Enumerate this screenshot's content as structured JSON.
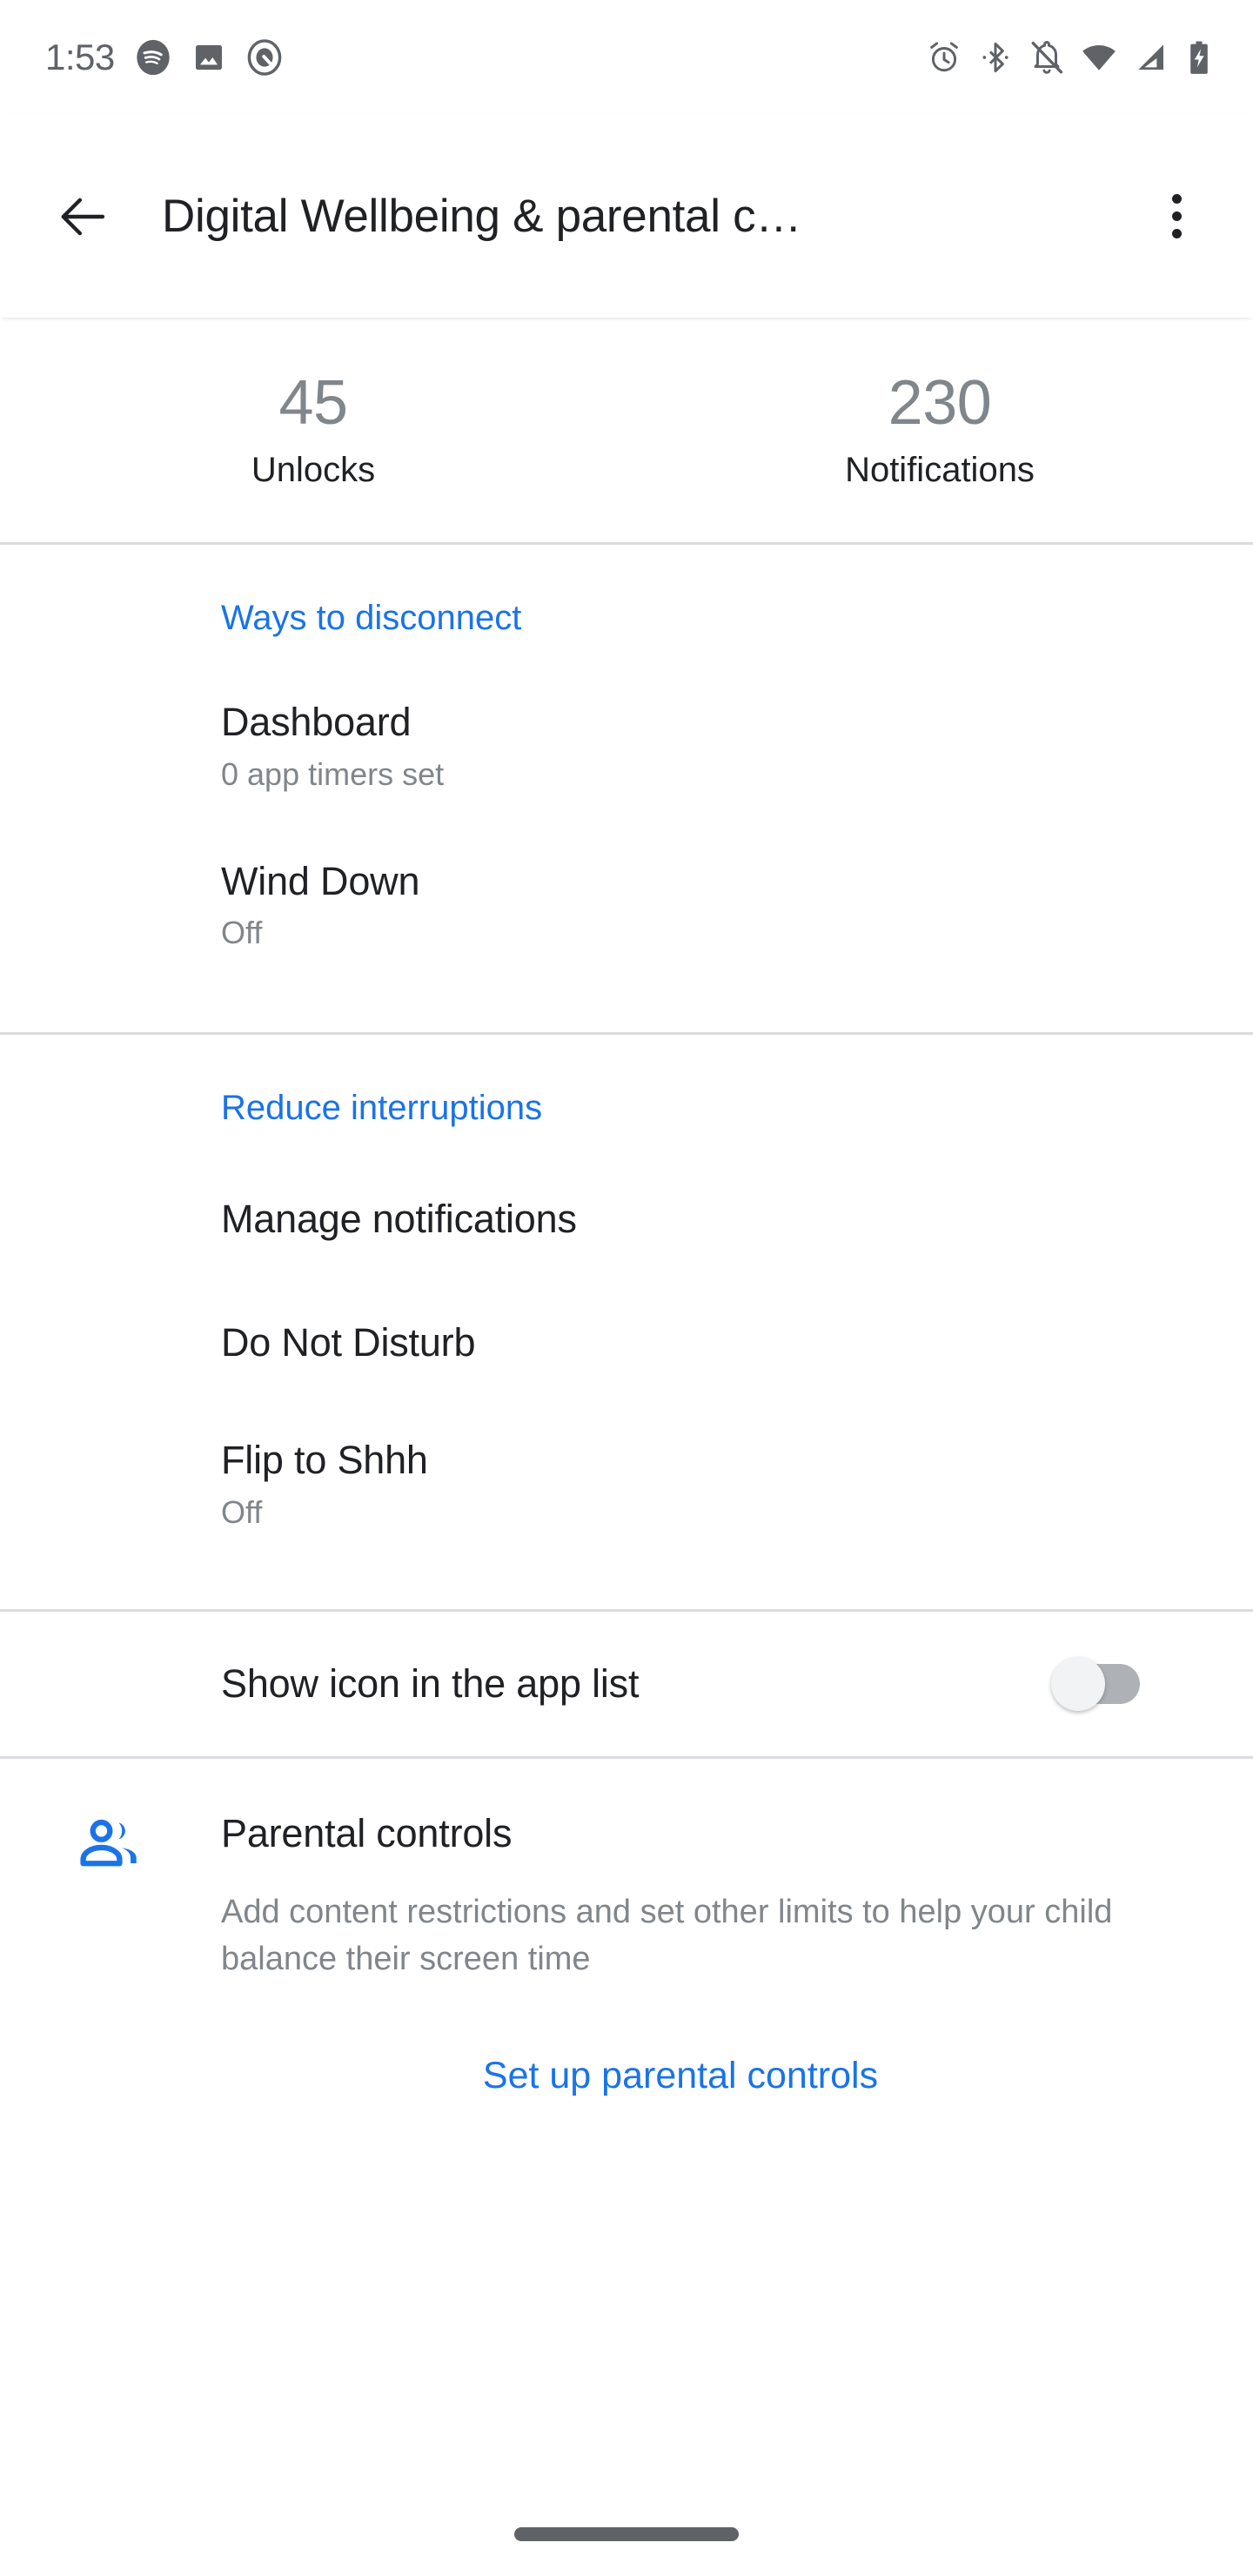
{
  "status_bar": {
    "time": "1:53",
    "left_icons": [
      "spotify-icon",
      "photos-image-icon",
      "android-auto-icon"
    ],
    "right_icons": [
      "alarm-icon",
      "bluetooth-icon",
      "notifications-off-icon",
      "wifi-icon",
      "cellular-signal-icon",
      "battery-charging-icon"
    ]
  },
  "toolbar": {
    "back_label": "back-arrow",
    "title": "Digital Wellbeing & parental c…",
    "overflow_label": "overflow-menu"
  },
  "stats": [
    {
      "value": "45",
      "label": "Unlocks"
    },
    {
      "value": "230",
      "label": "Notifications"
    }
  ],
  "sections": [
    {
      "header": "Ways to disconnect",
      "items": [
        {
          "title": "Dashboard",
          "subtitle": "0 app timers set"
        },
        {
          "title": "Wind Down",
          "subtitle": "Off"
        }
      ]
    },
    {
      "header": "Reduce interruptions",
      "items": [
        {
          "title": "Manage notifications",
          "subtitle": ""
        },
        {
          "title": "Do Not Disturb",
          "subtitle": ""
        },
        {
          "title": "Flip to Shhh",
          "subtitle": "Off"
        }
      ]
    }
  ],
  "show_icon_row": {
    "label": "Show icon in the app list",
    "toggle_state": "off"
  },
  "parental_controls": {
    "icon": "people-supervised-icon",
    "title": "Parental controls",
    "description": "Add content restrictions and set other limits to help your child balance their screen time",
    "cta_label": "Set up parental controls"
  },
  "colors": {
    "accent_blue": "#1a73e8",
    "primary_text": "#202124",
    "secondary_text": "#80868b",
    "divider": "#dadce0",
    "status_icon": "#5f6368"
  }
}
